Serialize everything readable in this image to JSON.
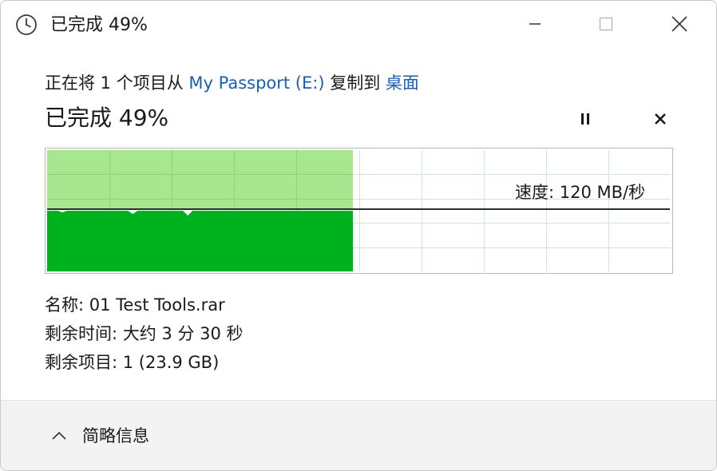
{
  "window": {
    "title": "已完成 49%"
  },
  "header": {
    "prefix": "正在将 1 个项目从 ",
    "source": "My Passport (E:)",
    "middle": " 复制到 ",
    "destination": "桌面",
    "progress_text": "已完成 49%"
  },
  "progress": {
    "percent": 49
  },
  "graph": {
    "speed_text": "速度: 120 MB/秒",
    "fill_light": "#a8e690",
    "fill_dark": "#00b21d",
    "grid_color": "#cfe6cf",
    "border_color": "#b8b8b8"
  },
  "details": {
    "name": "名称: 01 Test Tools.rar",
    "time_remaining": "剩余时间: 大约 3 分 30 秒",
    "items_remaining": "剩余项目: 1 (23.9 GB)"
  },
  "footer": {
    "toggle_label": "简略信息"
  },
  "icons": {
    "title": "clock-icon",
    "minimize": "minimize-icon",
    "maximize": "maximize-icon",
    "close": "close-icon",
    "pause": "pause-icon",
    "cancel": "cancel-icon",
    "toggle": "chevron-up-icon"
  }
}
